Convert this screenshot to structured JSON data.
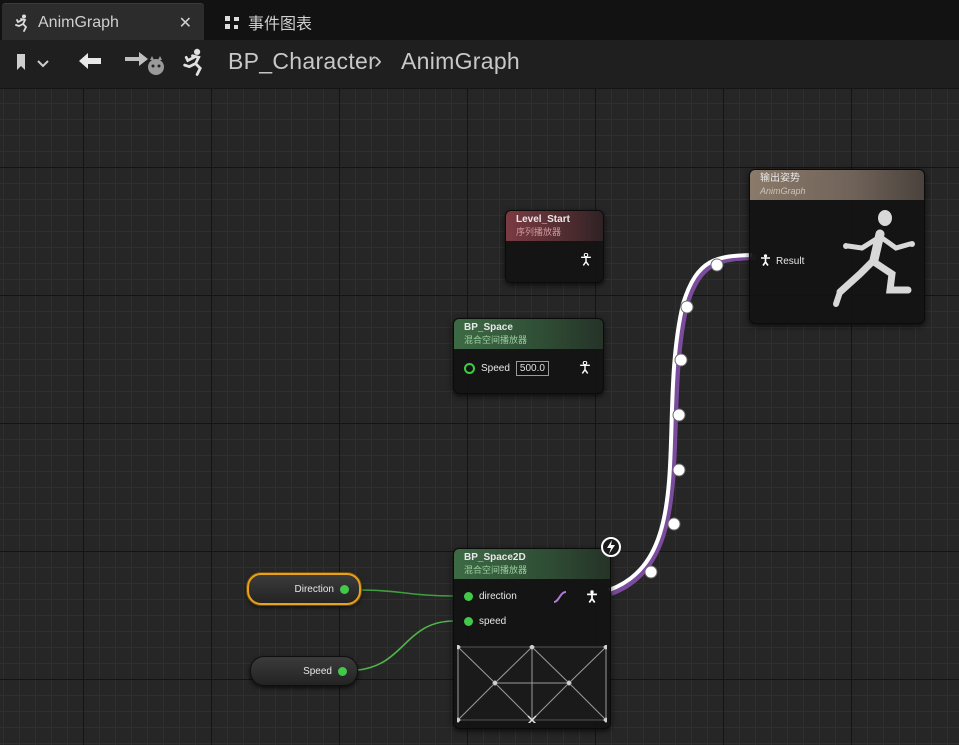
{
  "tabs": [
    {
      "label": "AnimGraph",
      "active": true
    },
    {
      "label": "事件图表",
      "active": false
    }
  ],
  "breadcrumb": {
    "root": "BP_Character",
    "separator": "›",
    "current": "AnimGraph"
  },
  "nodes": {
    "output_pose": {
      "title": "输出姿势",
      "subtitle": "AnimGraph",
      "pin": "Result"
    },
    "level_start": {
      "title": "Level_Start",
      "subtitle": "序列播放器"
    },
    "bp_space": {
      "title": "BP_Space",
      "subtitle": "混合空间播放器",
      "pin": "Speed",
      "value": "500.0"
    },
    "bp_space2d": {
      "title": "BP_Space2D",
      "subtitle": "混合空间播放器",
      "pins": [
        "direction",
        "speed"
      ]
    },
    "direction_var": {
      "label": "Direction"
    },
    "speed_var": {
      "label": "Speed"
    }
  },
  "colors": {
    "float_pin": "#42c94a",
    "pose_wire": "#ffffff",
    "selection": "#e8a21a"
  }
}
